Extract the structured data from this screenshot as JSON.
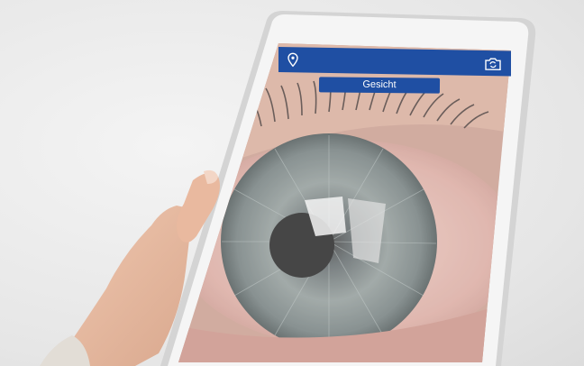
{
  "app": {
    "location_icon": "map-pin-icon",
    "camera_icon": "camera-switch-icon",
    "face_button_label": "Gesicht"
  },
  "colors": {
    "app_bar": "#1f4fa3",
    "tablet_frame": "#c9c9c9",
    "background": "#ececec"
  }
}
